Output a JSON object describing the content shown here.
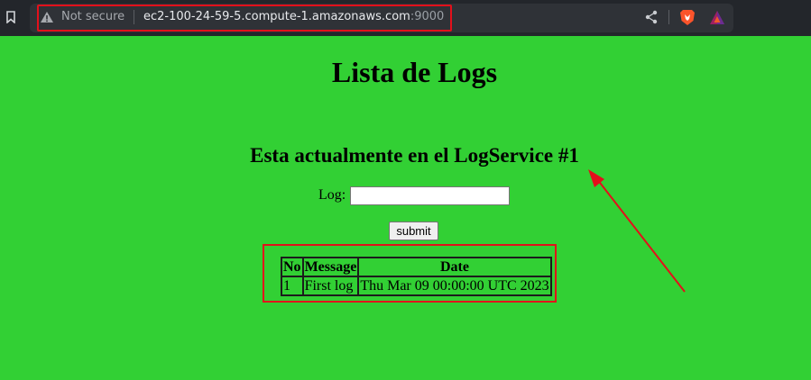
{
  "browser": {
    "security_label": "Not secure",
    "url_host": "ec2-100-24-59-5.compute-1.amazonaws.com",
    "url_port": ":9000",
    "annotation_color": "#e3101b",
    "icons": [
      "bookmark-icon",
      "warning-icon",
      "share-icon",
      "brave-shield-icon",
      "brave-rewards-icon"
    ]
  },
  "page": {
    "background": "#32d034",
    "title": "Lista de Logs",
    "service_heading": "Esta actualmente en el LogService #1",
    "form": {
      "log_label": "Log:",
      "log_value": "",
      "submit_label": "submit"
    },
    "table": {
      "headers": [
        "No",
        "Message",
        "Date"
      ],
      "rows": [
        [
          "1",
          "First log",
          "Thu Mar 09 00:00:00 UTC 2023"
        ]
      ]
    }
  }
}
